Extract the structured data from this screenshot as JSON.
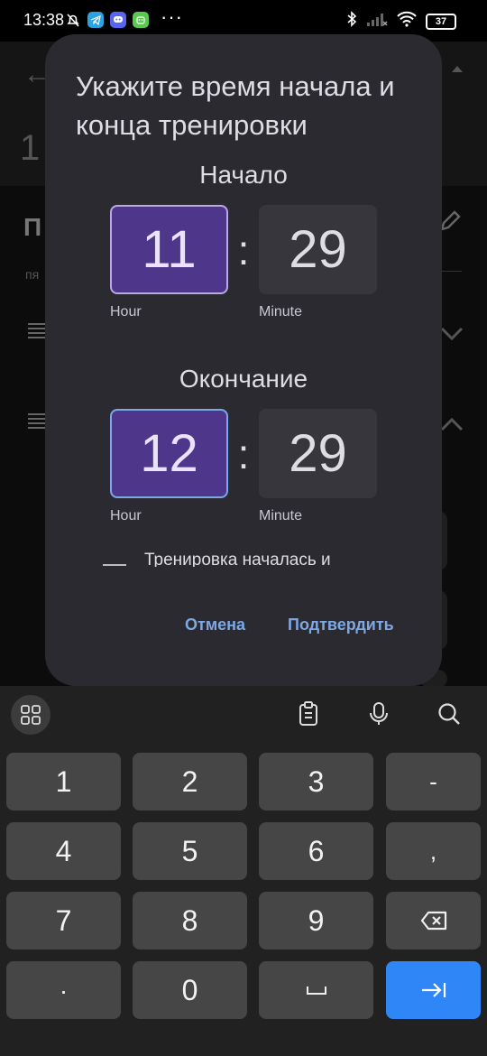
{
  "status_bar": {
    "time": "13:38",
    "more": "···",
    "battery": "37"
  },
  "background": {
    "back_icon": "←",
    "number": "1",
    "title": "П",
    "subtitle": "пя"
  },
  "dialog": {
    "title": "Укажите время начала и конца тренировки",
    "start": {
      "label": "Начало",
      "hour": "11",
      "minute": "29",
      "hour_label": "Hour",
      "minute_label": "Minute"
    },
    "end": {
      "label": "Окончание",
      "hour": "12",
      "minute": "29",
      "hour_label": "Hour",
      "minute_label": "Minute"
    },
    "colon": ":",
    "checkbox_text": "Тренировка началась и",
    "cancel": "Отмена",
    "confirm": "Подтвердить",
    "colors": {
      "surface": "#2b2a30",
      "hour_box": "#4e368b",
      "minute_box": "#37363d",
      "action": "#7ea8e3"
    }
  },
  "keyboard": {
    "rows": [
      [
        "1",
        "2",
        "3",
        "-"
      ],
      [
        "4",
        "5",
        "6",
        ","
      ],
      [
        "7",
        "8",
        "9",
        "⌫"
      ],
      [
        ".",
        "0",
        "␣",
        "⇥"
      ]
    ],
    "colors": {
      "key": "#464646",
      "action_key": "#2f86f6",
      "background": "#212121"
    }
  }
}
